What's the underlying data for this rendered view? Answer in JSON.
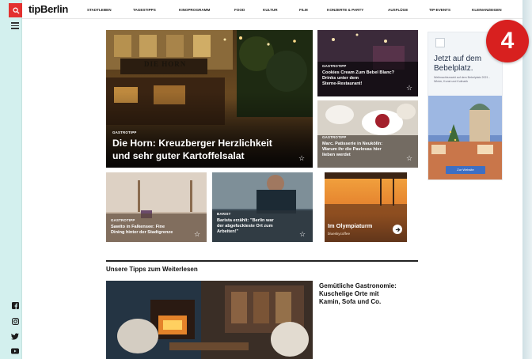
{
  "header": {
    "logo": "tipBerlin",
    "nav_items": [
      "STADTLEBEN",
      "TAGESTIPPS",
      "KINOPROGRAMM",
      "FOOD",
      "KULTUR",
      "FILM",
      "KONZERTE & PARTY",
      "AUSFLÜGE",
      "TIP-EVENTS",
      "KLEINANZEIGEN"
    ]
  },
  "hero": {
    "kicker": "GASTROTIPP",
    "title_line1": "Die Horn: Kreuzberger Herzlichkeit",
    "title_line2": "und sehr guter Kartoffelsalat",
    "sign_text": "DIE HORN"
  },
  "cards": {
    "c1": {
      "kicker": "GASTROTIPP",
      "title_line1": "Cookies Cream Zum Bebel Blanc?",
      "title_line2": "Drinks unter dem",
      "title_line3": "Sterne-Restaurant!"
    },
    "c2": {
      "kicker": "GASTROTIPP",
      "title_line1": "Marc. Patisserie in Neukölln:",
      "title_line2": "Warum ihr die Pavlovas hier",
      "title_line3": "lieben werdet"
    },
    "c3": {
      "kicker": "GASTROTIPP",
      "title_line1": "Sawito in Falkensee: Fine",
      "title_line2": "Dining hinter der Stadtgrenze"
    },
    "c4": {
      "kicker": "BARIST",
      "title_line1": "Barista erzählt: \"Berlin war",
      "title_line2": "der abgefuckteste Ort zum",
      "title_line3": "Arbeiten!\""
    },
    "c5": {
      "title": "Im Olympiaturm",
      "sub": "blueskycoffee"
    }
  },
  "ad": {
    "headline_line1": "Jetzt auf dem",
    "headline_line2": "Bebelplatz.",
    "small": "Weihnachtsmarkt auf dem Bebelplatz 2021 - Winter, Kunst und Kulinarik",
    "button": "Zur Website"
  },
  "section": {
    "heading": "Unsere Tipps zum Weiterlesen",
    "story_title_line1": "Gemütliche Gastronomie:",
    "story_title_line2": "Kuschelige Orte mit",
    "story_title_line3": "Kamin, Sofa und Co."
  },
  "badge": "4",
  "colors": {
    "brand_red": "#e3312f",
    "rail": "#d3f0ee",
    "badge": "#d8201f"
  },
  "icons": [
    "search-icon",
    "menu-icon",
    "facebook-icon",
    "instagram-icon",
    "twitter-icon",
    "youtube-icon",
    "star-icon",
    "arrow-right-icon"
  ]
}
